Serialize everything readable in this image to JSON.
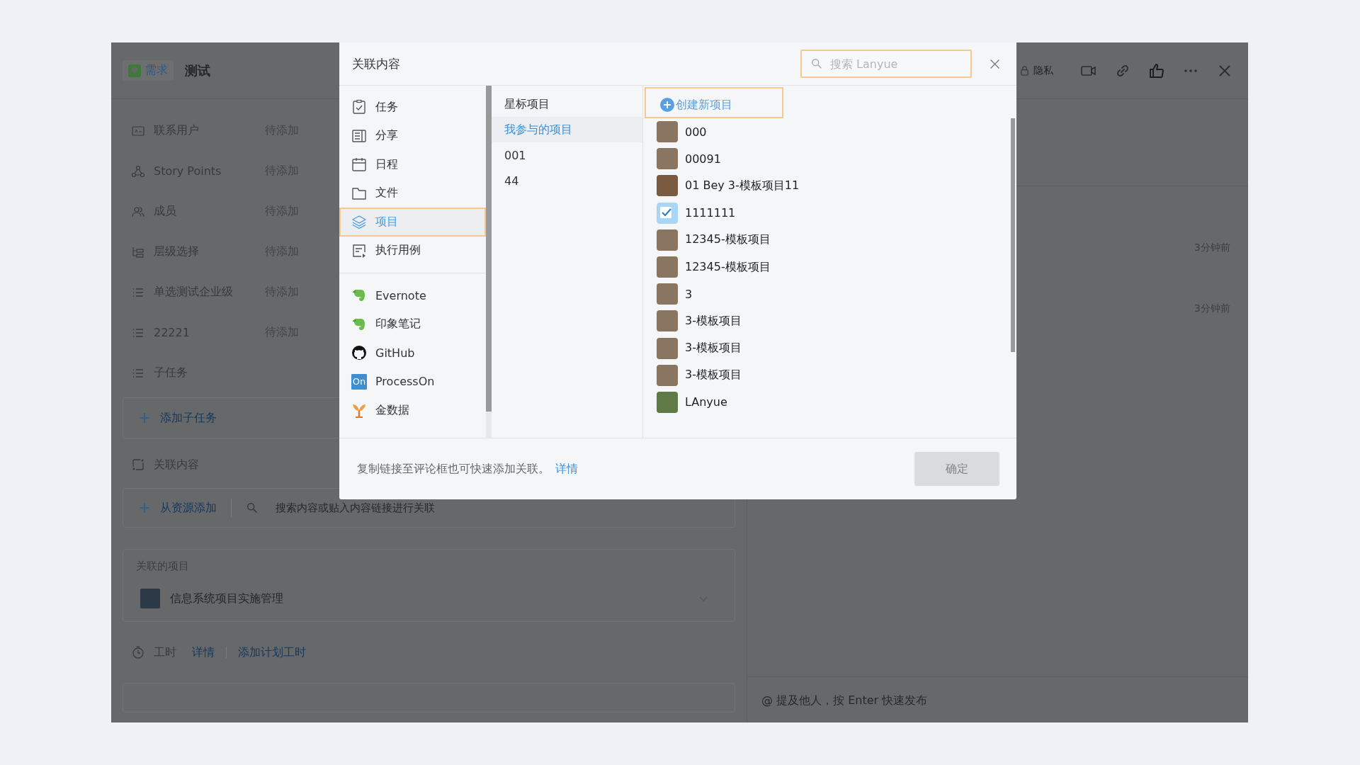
{
  "app": {
    "tag": "需求",
    "title": "测试",
    "privacy": "隐私"
  },
  "fields": [
    {
      "kind": "contact",
      "label": "联系用户",
      "value": "待添加"
    },
    {
      "kind": "points",
      "label": "Story Points",
      "value": "待添加"
    },
    {
      "kind": "members",
      "label": "成员",
      "value": "待添加"
    },
    {
      "kind": "tree",
      "label": "层级选择",
      "value": "待添加"
    },
    {
      "kind": "list",
      "label": "单选测试企业级",
      "value": "待添加"
    },
    {
      "kind": "list",
      "label": "22221",
      "value": "待添加"
    },
    {
      "kind": "list",
      "label": "子任务"
    }
  ],
  "add_subtask": "添加子任务",
  "related": {
    "heading": "关联内容",
    "add_button": "从资源添加",
    "search_placeholder": "搜索内容或贴入内容链接进行关联"
  },
  "linked_projects": {
    "heading": "关联的项目",
    "items": [
      {
        "name": "信息系统项目实施管理"
      }
    ]
  },
  "work_hours": {
    "label": "工时",
    "details_link": "详情",
    "add_link": "添加计划工时"
  },
  "activity": {
    "times": [
      "3分钟前",
      "3分钟前"
    ],
    "comment_placeholder": "@ 提及他人，按 Enter 快速发布"
  },
  "dialog": {
    "title": "关联内容",
    "search": {
      "placeholder": "搜索 Lanyue",
      "focused": true
    },
    "category_groups": [
      [
        {
          "kind": "task",
          "label": "任务",
          "selected": false
        },
        {
          "kind": "share",
          "label": "分享",
          "selected": false
        },
        {
          "kind": "calendar",
          "label": "日程",
          "selected": false
        },
        {
          "kind": "file",
          "label": "文件",
          "selected": false
        },
        {
          "kind": "project",
          "label": "项目",
          "selected": true
        },
        {
          "kind": "testcase",
          "label": "执行用例",
          "selected": false
        }
      ],
      [
        {
          "kind": "evernote",
          "label": "Evernote",
          "selected": false
        },
        {
          "kind": "evernote",
          "label": "印象笔记",
          "selected": false
        },
        {
          "kind": "github",
          "label": "GitHub",
          "selected": false
        },
        {
          "kind": "processon",
          "label": "ProcessOn",
          "logo_text": "On",
          "selected": false
        },
        {
          "kind": "jinshuju",
          "label": "金数据",
          "selected": false
        }
      ]
    ],
    "filters": [
      {
        "label": "星标项目",
        "selected": false
      },
      {
        "label": "我参与的项目",
        "selected": true
      },
      {
        "label": "001",
        "selected": false
      },
      {
        "label": "44",
        "selected": false
      }
    ],
    "create_button": {
      "label": "创建新项目",
      "focused": true
    },
    "projects": [
      {
        "name": "000",
        "kind": "sketch"
      },
      {
        "name": "00091",
        "kind": "sketch"
      },
      {
        "name": "01 Bey 3-模板项目11",
        "kind": "street"
      },
      {
        "name": "1111111",
        "kind": "check"
      },
      {
        "name": "12345-模板项目",
        "kind": "sketch"
      },
      {
        "name": "12345-模板项目",
        "kind": "sketch"
      },
      {
        "name": "3",
        "kind": "sketch"
      },
      {
        "name": "3-模板项目",
        "kind": "sketch"
      },
      {
        "name": "3-模板项目",
        "kind": "sketch"
      },
      {
        "name": "3-模板项目",
        "kind": "sketch"
      },
      {
        "name": "LAnyue",
        "kind": "tree"
      }
    ],
    "hint": "复制链接至评论框也可快速添加关联。",
    "hint_link": "详情",
    "confirm": {
      "label": "确定",
      "disabled": true
    }
  }
}
